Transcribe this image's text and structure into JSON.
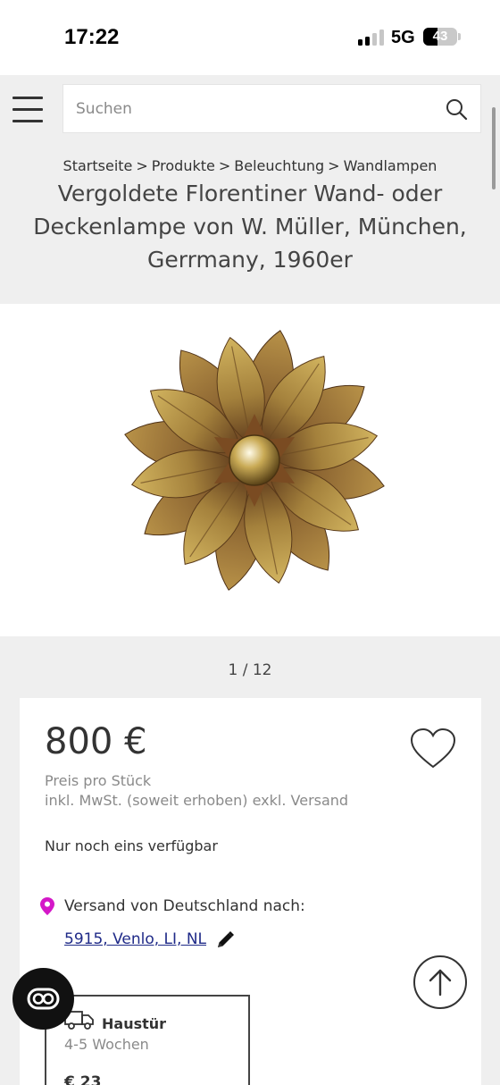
{
  "status_bar": {
    "time": "17:22",
    "network": "5G",
    "battery_percent": "43",
    "battery_level": 0.43,
    "signal_bars_active": 2,
    "signal_bars_total": 4
  },
  "header": {
    "search_placeholder": "Suchen",
    "menu_icon": "hamburger-menu-icon",
    "search_icon": "magnifier-icon"
  },
  "breadcrumb": [
    "Startseite",
    "Produkte",
    "Beleuchtung",
    "Wandlampen"
  ],
  "breadcrumb_separator": ">",
  "product": {
    "title": "Vergoldete Florentiner Wand- oder Deckenlampe von W. Müller, München, Gerrmany, 1960er",
    "image_counter": "1 / 12",
    "price": "800 €",
    "unit": "Preis pro Stück",
    "tax_note": "inkl. MwSt. (soweit erhoben) exkl. Versand",
    "availability": "Nur noch eins verfügbar"
  },
  "shipping": {
    "label": "Versand von Deutschland nach:",
    "location": "5915, Venlo, LI, NL",
    "option_title": "Haustür",
    "option_time": "4-5 Wochen",
    "option_price": "€ 23"
  },
  "colors": {
    "background": "#efefef",
    "link": "#1f2a88",
    "pin": "#d418c8",
    "text": "#333333",
    "muted": "#8a8a8a"
  },
  "icons": {
    "wishlist": "heart-outline-icon",
    "location": "map-pin-icon",
    "edit": "pencil-icon",
    "delivery": "truck-icon",
    "scroll_top": "arrow-up-icon",
    "chat": "chat-logo-icon"
  }
}
